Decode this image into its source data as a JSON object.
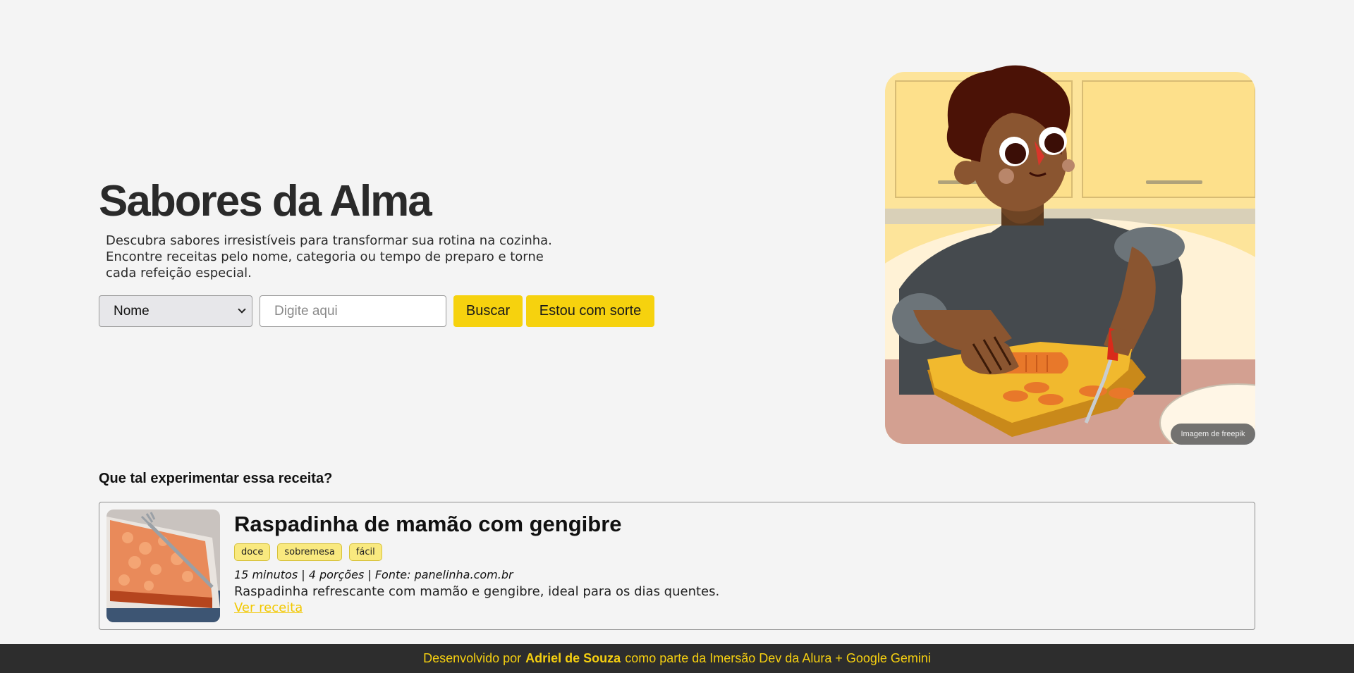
{
  "hero": {
    "title": "Sabores da Alma",
    "description": "Descubra sabores irresistíveis para transformar sua rotina na cozinha. Encontre receitas pelo nome, categoria ou tempo de preparo e torne cada refeição especial."
  },
  "search": {
    "filter_selected": "Nome",
    "placeholder": "Digite aqui",
    "value": "",
    "search_label": "Buscar",
    "lucky_label": "Estou com sorte"
  },
  "illustration": {
    "credit": "Imagem de freepik"
  },
  "suggestion": {
    "heading": "Que tal experimentar essa receita?",
    "recipe": {
      "name": "Raspadinha de mamão com gengibre",
      "tags": [
        "doce",
        "sobremesa",
        "fácil"
      ],
      "meta": "15 minutos | 4 porções | Fonte: panelinha.com.br",
      "summary": "Raspadinha refrescante com mamão e gengibre, ideal para os dias quentes.",
      "link_label": "Ver receita"
    }
  },
  "footer": {
    "prefix": "Desenvolvido por",
    "author": "Adriel de Souza",
    "suffix": "como parte da Imersão Dev da Alura + Google Gemini"
  },
  "colors": {
    "accent": "#f6d20e",
    "background": "#f4f4f4",
    "footer_bg": "#2d2d2d",
    "tag_bg": "#f9e97f"
  }
}
